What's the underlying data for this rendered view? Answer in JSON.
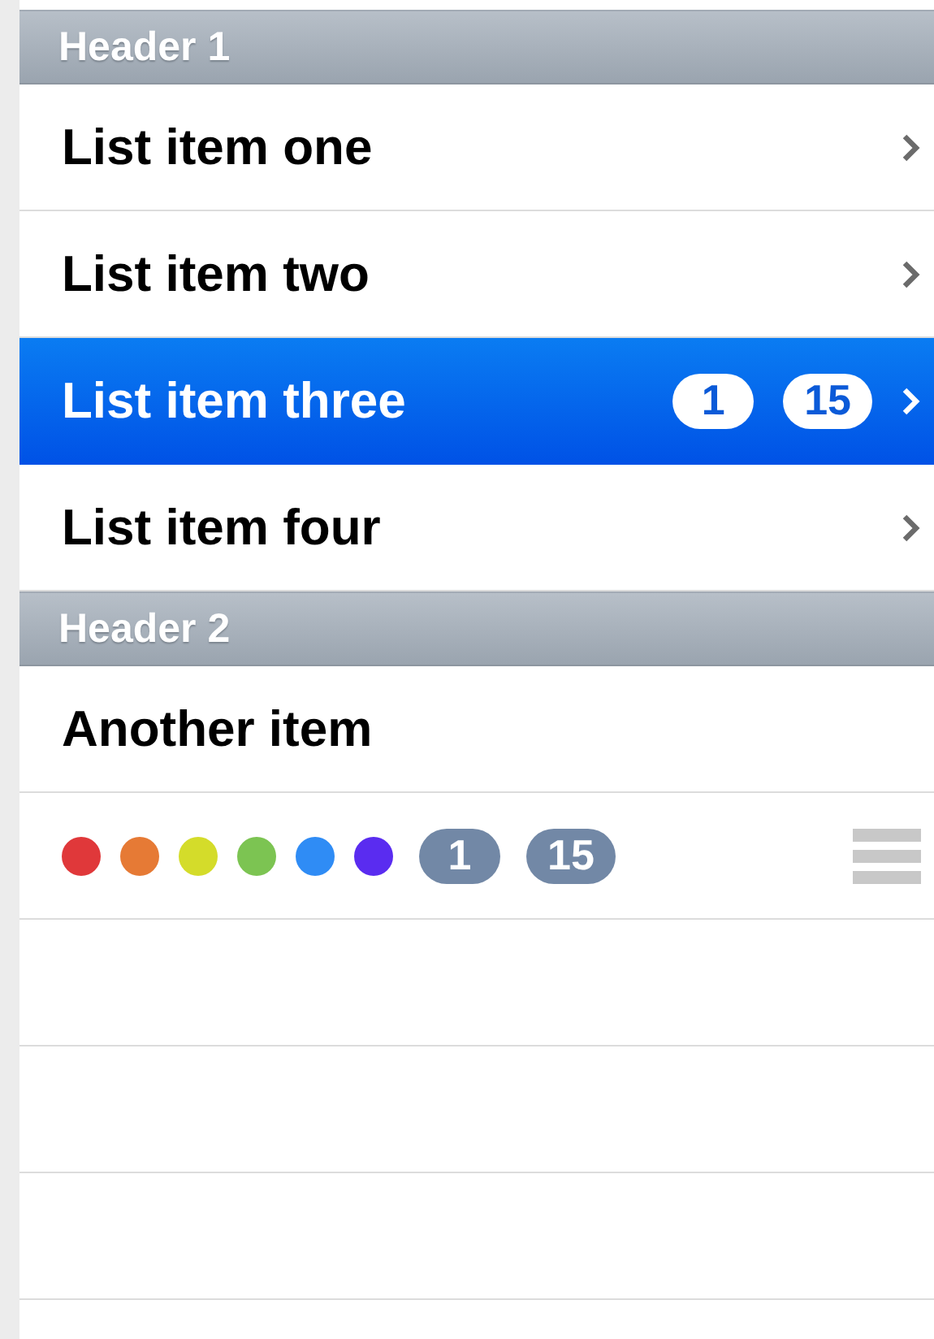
{
  "sections": [
    {
      "header": "Header 1",
      "rows": [
        {
          "kind": "item",
          "label": "List item one",
          "selected": false,
          "chevron": true,
          "badges": []
        },
        {
          "kind": "item",
          "label": "List item two",
          "selected": false,
          "chevron": true,
          "badges": []
        },
        {
          "kind": "item",
          "label": "List item three",
          "selected": true,
          "chevron": true,
          "badges": [
            "1",
            "15"
          ]
        },
        {
          "kind": "item",
          "label": "List item four",
          "selected": false,
          "chevron": true,
          "badges": []
        }
      ]
    },
    {
      "header": "Header 2",
      "rows": [
        {
          "kind": "item",
          "label": "Another item",
          "selected": false,
          "chevron": false,
          "badges": []
        },
        {
          "kind": "swatches",
          "dots": [
            {
              "color": "#e0383a"
            },
            {
              "color": "#e67a35"
            },
            {
              "color": "#d4dc2a"
            },
            {
              "color": "#7cc452"
            },
            {
              "color": "#2f8cf5"
            },
            {
              "color": "#5a2cf0"
            }
          ],
          "badges": [
            "1",
            "15"
          ],
          "grip": true
        }
      ]
    }
  ]
}
